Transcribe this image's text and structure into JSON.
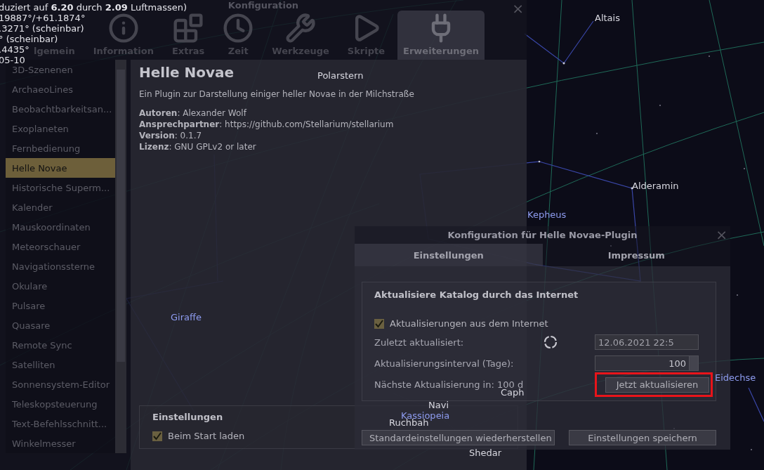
{
  "sky_labels": [
    {
      "text": "Altais",
      "kind": "star"
    },
    {
      "text": "Polarstern",
      "kind": "star"
    },
    {
      "text": "Alderamin",
      "kind": "star"
    },
    {
      "text": "Kepheus",
      "kind": "constellation"
    },
    {
      "text": "Giraffe",
      "kind": "constellation"
    },
    {
      "text": "Eidechse",
      "kind": "constellation"
    },
    {
      "text": "Caph",
      "kind": "star"
    },
    {
      "text": "Navi",
      "kind": "star"
    },
    {
      "text": "Kassiopeia",
      "kind": "constellation"
    },
    {
      "text": "Ruchbah",
      "kind": "star"
    },
    {
      "text": "Shedar",
      "kind": "star"
    }
  ],
  "info_lines": [
    "duziert auf **6.20** durch **2.09** Luftmassen)",
    "19887°/+61.1874°",
    ".3271° (scheinbar)",
    "° (scheinbar)",
    ".4435°",
    "05-10"
  ],
  "config_dialog": {
    "title": "Konfiguration",
    "close": "×",
    "tabs": [
      {
        "label": "lgemein",
        "selected": false
      },
      {
        "label": "Information",
        "selected": false
      },
      {
        "label": "Extras",
        "selected": false
      },
      {
        "label": "Zeit",
        "selected": false
      },
      {
        "label": "Werkzeuge",
        "selected": false
      },
      {
        "label": "Skripte",
        "selected": false
      },
      {
        "label": "Erweiterungen",
        "selected": true
      }
    ],
    "plugins": [
      {
        "label": "3D-Szenenen",
        "selected": false
      },
      {
        "label": "ArchaeoLines",
        "selected": false
      },
      {
        "label": "Beobachtbarkeitsan...",
        "selected": false
      },
      {
        "label": "Exoplaneten",
        "selected": false
      },
      {
        "label": "Fernbedienung",
        "selected": false
      },
      {
        "label": "Helle Novae",
        "selected": true
      },
      {
        "label": "Historische Superm...",
        "selected": false
      },
      {
        "label": "Kalender",
        "selected": false
      },
      {
        "label": "Mauskoordinaten",
        "selected": false
      },
      {
        "label": "Meteorschauer",
        "selected": false
      },
      {
        "label": "Navigationssterne",
        "selected": false
      },
      {
        "label": "Okulare",
        "selected": false
      },
      {
        "label": "Pulsare",
        "selected": false
      },
      {
        "label": "Quasare",
        "selected": false
      },
      {
        "label": "Remote Sync",
        "selected": false
      },
      {
        "label": "Satelliten",
        "selected": false
      },
      {
        "label": "Sonnensystem-Editor",
        "selected": false
      },
      {
        "label": "Teleskopsteuerung",
        "selected": false
      },
      {
        "label": "Text-Befehlsschnitt...",
        "selected": false
      },
      {
        "label": "Winkelmesser",
        "selected": false
      }
    ],
    "plugin_title": "Helle Novae",
    "plugin_description": "Ein Plugin zur Darstellung einiger heller Novae in der Milchstraße",
    "plugin_meta": [
      "**Autoren**: Alexander Wolf",
      "**Ansprechpartner**: https://github.com/Stellarium/stellarium",
      "**Version**: 0.1.7",
      "**Lizenz**: GNU GPLv2 or later"
    ],
    "settings_group": {
      "title": "Einstellungen",
      "load_at_start": {
        "label": "Beim Start laden",
        "checked": true
      }
    }
  },
  "plugin_dialog": {
    "title": "Konfiguration für Helle Novae-Plugin",
    "close": "×",
    "tabs": [
      {
        "label": "Einstellungen",
        "selected": true
      },
      {
        "label": "Impressum",
        "selected": false
      }
    ],
    "group_title": "Aktualisiere Katalog durch das Internet",
    "updates_checkbox": {
      "label": "Aktualisierungen aus dem Internet",
      "checked": true
    },
    "last_updated_label": "Zuletzt aktualisiert:",
    "last_updated_value": "12.06.2021 22:5",
    "interval_label": "Aktualisierungsinterval (Tage):",
    "interval_value": "100",
    "next_update": "Nächste Aktualisierung in: 100 d",
    "update_button": {
      "label": "Jetzt aktualisieren",
      "highlighted": true
    },
    "buttons": [
      "Standardeinstellungen wiederherstellen",
      "Einstellungen speichern"
    ]
  }
}
